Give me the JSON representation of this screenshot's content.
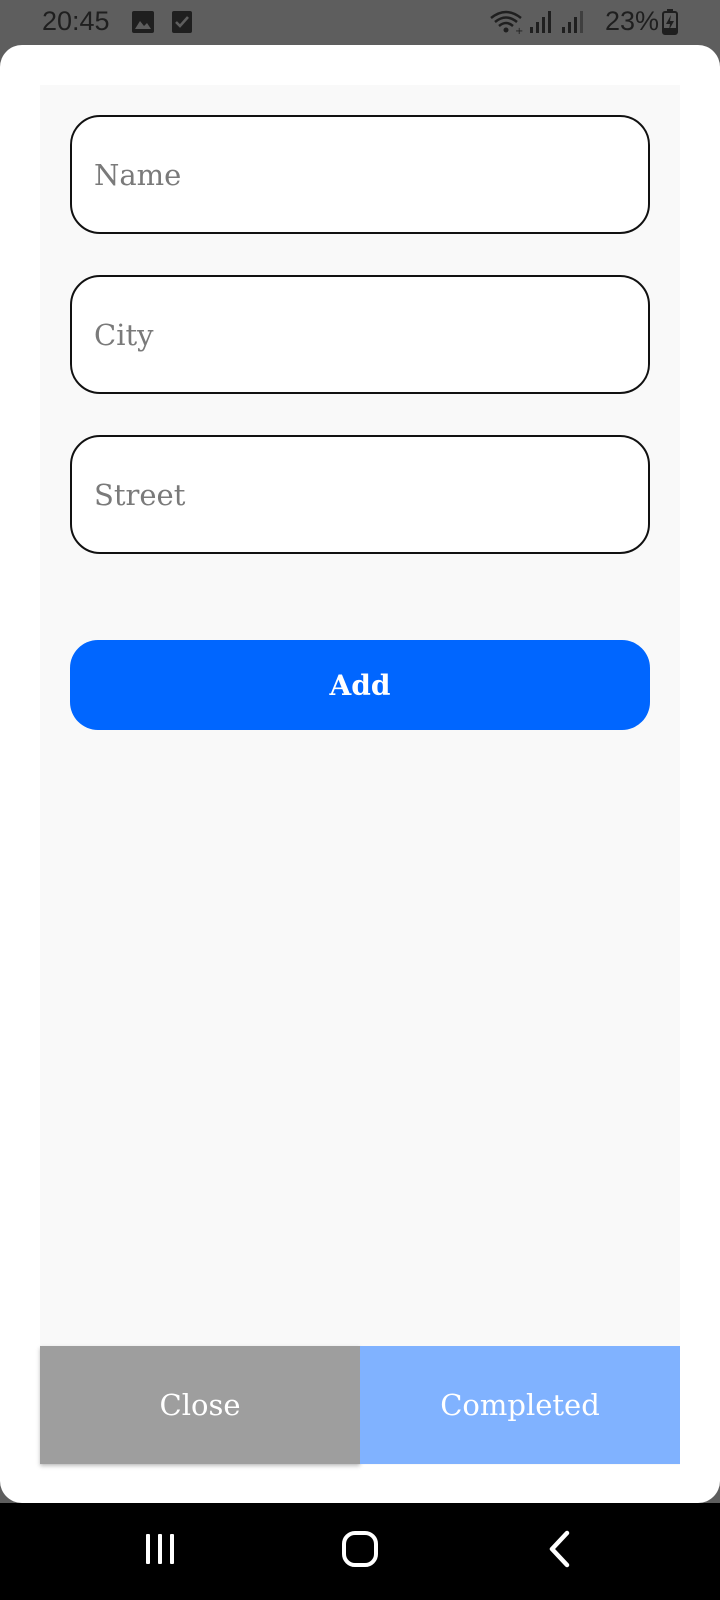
{
  "status_bar": {
    "time": "20:45",
    "battery_percent": "23%",
    "icons": [
      "gallery-icon",
      "checkbox-icon",
      "wifi-icon",
      "signal-icon",
      "signal-icon",
      "battery-charging-icon"
    ]
  },
  "form": {
    "name_placeholder": "Name",
    "city_placeholder": "City",
    "street_placeholder": "Street",
    "add_label": "Add"
  },
  "footer": {
    "close_label": "Close",
    "completed_label": "Completed"
  },
  "navigation": {
    "icons": [
      "recent-apps-icon",
      "home-icon",
      "back-icon"
    ]
  },
  "colors": {
    "accent": "#0066ff",
    "completed_bg": "#80b2ff",
    "close_bg": "#9e9e9e",
    "status_bar_bg": "#5e5e5e",
    "nav_bar_bg": "#000000"
  }
}
